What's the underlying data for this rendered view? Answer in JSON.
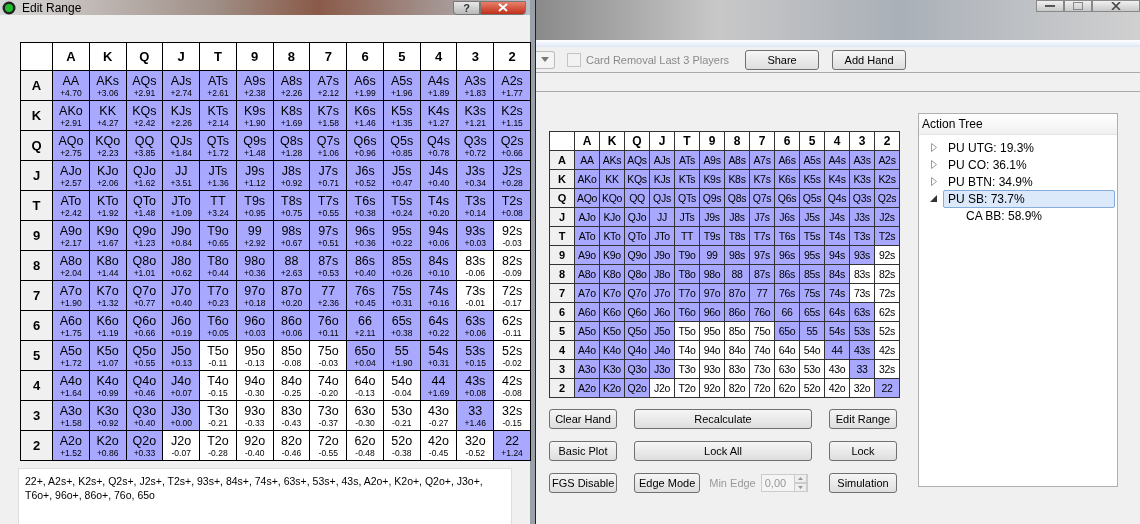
{
  "dialog": {
    "title": "Edit Range",
    "help_button": "?",
    "columns": [
      "A",
      "K",
      "Q",
      "J",
      "T",
      "9",
      "8",
      "7",
      "6",
      "5",
      "4",
      "3",
      "2"
    ],
    "rows": [
      {
        "rank": "A",
        "cells": [
          {
            "hand": "AA",
            "ev": "+4.70",
            "selected": true
          },
          {
            "hand": "AKs",
            "ev": "+3.06",
            "selected": true
          },
          {
            "hand": "AQs",
            "ev": "+2.91",
            "selected": true
          },
          {
            "hand": "AJs",
            "ev": "+2.74",
            "selected": true
          },
          {
            "hand": "ATs",
            "ev": "+2.61",
            "selected": true
          },
          {
            "hand": "A9s",
            "ev": "+2.38",
            "selected": true
          },
          {
            "hand": "A8s",
            "ev": "+2.26",
            "selected": true
          },
          {
            "hand": "A7s",
            "ev": "+2.12",
            "selected": true
          },
          {
            "hand": "A6s",
            "ev": "+1.99",
            "selected": true
          },
          {
            "hand": "A5s",
            "ev": "+1.96",
            "selected": true
          },
          {
            "hand": "A4s",
            "ev": "+1.89",
            "selected": true
          },
          {
            "hand": "A3s",
            "ev": "+1.83",
            "selected": true
          },
          {
            "hand": "A2s",
            "ev": "+1.77",
            "selected": true
          }
        ]
      },
      {
        "rank": "K",
        "cells": [
          {
            "hand": "AKo",
            "ev": "+2.91",
            "selected": true
          },
          {
            "hand": "KK",
            "ev": "+4.27",
            "selected": true
          },
          {
            "hand": "KQs",
            "ev": "+2.42",
            "selected": true
          },
          {
            "hand": "KJs",
            "ev": "+2.26",
            "selected": true
          },
          {
            "hand": "KTs",
            "ev": "+2.14",
            "selected": true
          },
          {
            "hand": "K9s",
            "ev": "+1.90",
            "selected": true
          },
          {
            "hand": "K8s",
            "ev": "+1.69",
            "selected": true
          },
          {
            "hand": "K7s",
            "ev": "+1.58",
            "selected": true
          },
          {
            "hand": "K6s",
            "ev": "+1.46",
            "selected": true
          },
          {
            "hand": "K5s",
            "ev": "+1.35",
            "selected": true
          },
          {
            "hand": "K4s",
            "ev": "+1.27",
            "selected": true
          },
          {
            "hand": "K3s",
            "ev": "+1.21",
            "selected": true
          },
          {
            "hand": "K2s",
            "ev": "+1.15",
            "selected": true
          }
        ]
      },
      {
        "rank": "Q",
        "cells": [
          {
            "hand": "AQo",
            "ev": "+2.75",
            "selected": true
          },
          {
            "hand": "KQo",
            "ev": "+2.23",
            "selected": true
          },
          {
            "hand": "QQ",
            "ev": "+3.85",
            "selected": true
          },
          {
            "hand": "QJs",
            "ev": "+1.84",
            "selected": true
          },
          {
            "hand": "QTs",
            "ev": "+1.72",
            "selected": true
          },
          {
            "hand": "Q9s",
            "ev": "+1.48",
            "selected": true
          },
          {
            "hand": "Q8s",
            "ev": "+1.28",
            "selected": true
          },
          {
            "hand": "Q7s",
            "ev": "+1.06",
            "selected": true
          },
          {
            "hand": "Q6s",
            "ev": "+0.96",
            "selected": true
          },
          {
            "hand": "Q5s",
            "ev": "+0.85",
            "selected": true
          },
          {
            "hand": "Q4s",
            "ev": "+0.78",
            "selected": true
          },
          {
            "hand": "Q3s",
            "ev": "+0.72",
            "selected": true
          },
          {
            "hand": "Q2s",
            "ev": "+0.66",
            "selected": true
          }
        ]
      },
      {
        "rank": "J",
        "cells": [
          {
            "hand": "AJo",
            "ev": "+2.57",
            "selected": true
          },
          {
            "hand": "KJo",
            "ev": "+2.06",
            "selected": true
          },
          {
            "hand": "QJo",
            "ev": "+1.62",
            "selected": true
          },
          {
            "hand": "JJ",
            "ev": "+3.51",
            "selected": true
          },
          {
            "hand": "JTs",
            "ev": "+1.36",
            "selected": true
          },
          {
            "hand": "J9s",
            "ev": "+1.12",
            "selected": true
          },
          {
            "hand": "J8s",
            "ev": "+0.92",
            "selected": true
          },
          {
            "hand": "J7s",
            "ev": "+0.71",
            "selected": true
          },
          {
            "hand": "J6s",
            "ev": "+0.52",
            "selected": true
          },
          {
            "hand": "J5s",
            "ev": "+0.47",
            "selected": true
          },
          {
            "hand": "J4s",
            "ev": "+0.40",
            "selected": true
          },
          {
            "hand": "J3s",
            "ev": "+0.34",
            "selected": true
          },
          {
            "hand": "J2s",
            "ev": "+0.28",
            "selected": true
          }
        ]
      },
      {
        "rank": "T",
        "cells": [
          {
            "hand": "ATo",
            "ev": "+2.42",
            "selected": true
          },
          {
            "hand": "KTo",
            "ev": "+1.92",
            "selected": true
          },
          {
            "hand": "QTo",
            "ev": "+1.48",
            "selected": true
          },
          {
            "hand": "JTo",
            "ev": "+1.09",
            "selected": true
          },
          {
            "hand": "TT",
            "ev": "+3.24",
            "selected": true
          },
          {
            "hand": "T9s",
            "ev": "+0.95",
            "selected": true
          },
          {
            "hand": "T8s",
            "ev": "+0.75",
            "selected": true
          },
          {
            "hand": "T7s",
            "ev": "+0.55",
            "selected": true
          },
          {
            "hand": "T6s",
            "ev": "+0.38",
            "selected": true
          },
          {
            "hand": "T5s",
            "ev": "+0.24",
            "selected": true
          },
          {
            "hand": "T4s",
            "ev": "+0.20",
            "selected": true
          },
          {
            "hand": "T3s",
            "ev": "+0.14",
            "selected": true
          },
          {
            "hand": "T2s",
            "ev": "+0.08",
            "selected": true
          }
        ]
      },
      {
        "rank": "9",
        "cells": [
          {
            "hand": "A9o",
            "ev": "+2.17",
            "selected": true
          },
          {
            "hand": "K9o",
            "ev": "+1.67",
            "selected": true
          },
          {
            "hand": "Q9o",
            "ev": "+1.23",
            "selected": true
          },
          {
            "hand": "J9o",
            "ev": "+0.84",
            "selected": true
          },
          {
            "hand": "T9o",
            "ev": "+0.65",
            "selected": true
          },
          {
            "hand": "99",
            "ev": "+2.92",
            "selected": true
          },
          {
            "hand": "98s",
            "ev": "+0.67",
            "selected": true
          },
          {
            "hand": "97s",
            "ev": "+0.51",
            "selected": true
          },
          {
            "hand": "96s",
            "ev": "+0.36",
            "selected": true
          },
          {
            "hand": "95s",
            "ev": "+0.22",
            "selected": true
          },
          {
            "hand": "94s",
            "ev": "+0.06",
            "selected": true
          },
          {
            "hand": "93s",
            "ev": "+0.03",
            "selected": true
          },
          {
            "hand": "92s",
            "ev": "-0.03",
            "selected": false
          }
        ]
      },
      {
        "rank": "8",
        "cells": [
          {
            "hand": "A8o",
            "ev": "+2.04",
            "selected": true
          },
          {
            "hand": "K8o",
            "ev": "+1.44",
            "selected": true
          },
          {
            "hand": "Q8o",
            "ev": "+1.01",
            "selected": true
          },
          {
            "hand": "J8o",
            "ev": "+0.62",
            "selected": true
          },
          {
            "hand": "T8o",
            "ev": "+0.44",
            "selected": true
          },
          {
            "hand": "98o",
            "ev": "+0.36",
            "selected": true
          },
          {
            "hand": "88",
            "ev": "+2.63",
            "selected": true
          },
          {
            "hand": "87s",
            "ev": "+0.53",
            "selected": true
          },
          {
            "hand": "86s",
            "ev": "+0.40",
            "selected": true
          },
          {
            "hand": "85s",
            "ev": "+0.26",
            "selected": true
          },
          {
            "hand": "84s",
            "ev": "+0.10",
            "selected": true
          },
          {
            "hand": "83s",
            "ev": "-0.06",
            "selected": false
          },
          {
            "hand": "82s",
            "ev": "-0.09",
            "selected": false
          }
        ]
      },
      {
        "rank": "7",
        "cells": [
          {
            "hand": "A7o",
            "ev": "+1.90",
            "selected": true
          },
          {
            "hand": "K7o",
            "ev": "+1.32",
            "selected": true
          },
          {
            "hand": "Q7o",
            "ev": "+0.77",
            "selected": true
          },
          {
            "hand": "J7o",
            "ev": "+0.40",
            "selected": true
          },
          {
            "hand": "T7o",
            "ev": "+0.23",
            "selected": true
          },
          {
            "hand": "97o",
            "ev": "+0.18",
            "selected": true
          },
          {
            "hand": "87o",
            "ev": "+0.20",
            "selected": true
          },
          {
            "hand": "77",
            "ev": "+2.36",
            "selected": true
          },
          {
            "hand": "76s",
            "ev": "+0.45",
            "selected": true
          },
          {
            "hand": "75s",
            "ev": "+0.31",
            "selected": true
          },
          {
            "hand": "74s",
            "ev": "+0.16",
            "selected": true
          },
          {
            "hand": "73s",
            "ev": "-0.01",
            "selected": false
          },
          {
            "hand": "72s",
            "ev": "-0.17",
            "selected": false
          }
        ]
      },
      {
        "rank": "6",
        "cells": [
          {
            "hand": "A6o",
            "ev": "+1.75",
            "selected": true
          },
          {
            "hand": "K6o",
            "ev": "+1.19",
            "selected": true
          },
          {
            "hand": "Q6o",
            "ev": "+0.66",
            "selected": true
          },
          {
            "hand": "J6o",
            "ev": "+0.19",
            "selected": true
          },
          {
            "hand": "T6o",
            "ev": "+0.05",
            "selected": true
          },
          {
            "hand": "96o",
            "ev": "+0.03",
            "selected": true
          },
          {
            "hand": "86o",
            "ev": "+0.06",
            "selected": true
          },
          {
            "hand": "76o",
            "ev": "+0.11",
            "selected": true
          },
          {
            "hand": "66",
            "ev": "+2.11",
            "selected": true
          },
          {
            "hand": "65s",
            "ev": "+0.38",
            "selected": true
          },
          {
            "hand": "64s",
            "ev": "+0.22",
            "selected": true
          },
          {
            "hand": "63s",
            "ev": "+0.06",
            "selected": true
          },
          {
            "hand": "62s",
            "ev": "-0.11",
            "selected": false
          }
        ]
      },
      {
        "rank": "5",
        "cells": [
          {
            "hand": "A5o",
            "ev": "+1.72",
            "selected": true
          },
          {
            "hand": "K5o",
            "ev": "+1.07",
            "selected": true
          },
          {
            "hand": "Q5o",
            "ev": "+0.55",
            "selected": true
          },
          {
            "hand": "J5o",
            "ev": "+0.13",
            "selected": true
          },
          {
            "hand": "T5o",
            "ev": "-0.11",
            "selected": false
          },
          {
            "hand": "95o",
            "ev": "-0.13",
            "selected": false
          },
          {
            "hand": "85o",
            "ev": "-0.08",
            "selected": false
          },
          {
            "hand": "75o",
            "ev": "-0.03",
            "selected": false
          },
          {
            "hand": "65o",
            "ev": "+0.04",
            "selected": true
          },
          {
            "hand": "55",
            "ev": "+1.90",
            "selected": true
          },
          {
            "hand": "54s",
            "ev": "+0.31",
            "selected": true
          },
          {
            "hand": "53s",
            "ev": "+0.15",
            "selected": true
          },
          {
            "hand": "52s",
            "ev": "-0.02",
            "selected": false
          }
        ]
      },
      {
        "rank": "4",
        "cells": [
          {
            "hand": "A4o",
            "ev": "+1.64",
            "selected": true
          },
          {
            "hand": "K4o",
            "ev": "+0.99",
            "selected": true
          },
          {
            "hand": "Q4o",
            "ev": "+0.46",
            "selected": true
          },
          {
            "hand": "J4o",
            "ev": "+0.07",
            "selected": true
          },
          {
            "hand": "T4o",
            "ev": "-0.15",
            "selected": false
          },
          {
            "hand": "94o",
            "ev": "-0.30",
            "selected": false
          },
          {
            "hand": "84o",
            "ev": "-0.25",
            "selected": false
          },
          {
            "hand": "74o",
            "ev": "-0.20",
            "selected": false
          },
          {
            "hand": "64o",
            "ev": "-0.13",
            "selected": false
          },
          {
            "hand": "54o",
            "ev": "-0.04",
            "selected": false
          },
          {
            "hand": "44",
            "ev": "+1.69",
            "selected": true
          },
          {
            "hand": "43s",
            "ev": "+0.08",
            "selected": true
          },
          {
            "hand": "42s",
            "ev": "-0.08",
            "selected": false
          }
        ]
      },
      {
        "rank": "3",
        "cells": [
          {
            "hand": "A3o",
            "ev": "+1.58",
            "selected": true
          },
          {
            "hand": "K3o",
            "ev": "+0.92",
            "selected": true
          },
          {
            "hand": "Q3o",
            "ev": "+0.40",
            "selected": true
          },
          {
            "hand": "J3o",
            "ev": "+0.00",
            "selected": true
          },
          {
            "hand": "T3o",
            "ev": "-0.21",
            "selected": false
          },
          {
            "hand": "93o",
            "ev": "-0.33",
            "selected": false
          },
          {
            "hand": "83o",
            "ev": "-0.43",
            "selected": false
          },
          {
            "hand": "73o",
            "ev": "-0.37",
            "selected": false
          },
          {
            "hand": "63o",
            "ev": "-0.30",
            "selected": false
          },
          {
            "hand": "53o",
            "ev": "-0.21",
            "selected": false
          },
          {
            "hand": "43o",
            "ev": "-0.27",
            "selected": false
          },
          {
            "hand": "33",
            "ev": "+1.46",
            "selected": true
          },
          {
            "hand": "32s",
            "ev": "-0.15",
            "selected": false
          }
        ]
      },
      {
        "rank": "2",
        "cells": [
          {
            "hand": "A2o",
            "ev": "+1.52",
            "selected": true
          },
          {
            "hand": "K2o",
            "ev": "+0.86",
            "selected": true
          },
          {
            "hand": "Q2o",
            "ev": "+0.33",
            "selected": true
          },
          {
            "hand": "J2o",
            "ev": "-0.07",
            "selected": false
          },
          {
            "hand": "T2o",
            "ev": "-0.28",
            "selected": false
          },
          {
            "hand": "92o",
            "ev": "-0.40",
            "selected": false
          },
          {
            "hand": "82o",
            "ev": "-0.46",
            "selected": false
          },
          {
            "hand": "72o",
            "ev": "-0.55",
            "selected": false
          },
          {
            "hand": "62o",
            "ev": "-0.48",
            "selected": false
          },
          {
            "hand": "52o",
            "ev": "-0.38",
            "selected": false
          },
          {
            "hand": "42o",
            "ev": "-0.45",
            "selected": false
          },
          {
            "hand": "32o",
            "ev": "-0.52",
            "selected": false
          },
          {
            "hand": "22",
            "ev": "+1.24",
            "selected": true
          }
        ]
      }
    ],
    "range_text": "22+, A2s+, K2s+, Q2s+, J2s+, T2s+, 93s+, 84s+, 74s+, 63s+, 53s+, 43s, A2o+, K2o+, Q2o+, J3o+, T6o+, 96o+, 86o+, 76o, 65o"
  },
  "main": {
    "toolbar": {
      "card_removal": {
        "label": "Card Removal Last 3 Players",
        "checked": false,
        "disabled": true
      },
      "buttons": [
        "Share",
        "Add Hand"
      ]
    },
    "grid": {
      "columns": [
        "A",
        "K",
        "Q",
        "J",
        "T",
        "9",
        "8",
        "7",
        "6",
        "5",
        "4",
        "3",
        "2"
      ],
      "rows": [
        {
          "rank": "A",
          "cells": [
            {
              "hand": "AA",
              "selected": true
            },
            {
              "hand": "AKs",
              "selected": true
            },
            {
              "hand": "AQs",
              "selected": true
            },
            {
              "hand": "AJs",
              "selected": true
            },
            {
              "hand": "ATs",
              "selected": true
            },
            {
              "hand": "A9s",
              "selected": true
            },
            {
              "hand": "A8s",
              "selected": true
            },
            {
              "hand": "A7s",
              "selected": true
            },
            {
              "hand": "A6s",
              "selected": true
            },
            {
              "hand": "A5s",
              "selected": true
            },
            {
              "hand": "A4s",
              "selected": true
            },
            {
              "hand": "A3s",
              "selected": true
            },
            {
              "hand": "A2s",
              "selected": true
            }
          ]
        },
        {
          "rank": "K",
          "cells": [
            {
              "hand": "AKo",
              "selected": true
            },
            {
              "hand": "KK",
              "selected": true
            },
            {
              "hand": "KQs",
              "selected": true
            },
            {
              "hand": "KJs",
              "selected": true
            },
            {
              "hand": "KTs",
              "selected": true
            },
            {
              "hand": "K9s",
              "selected": true
            },
            {
              "hand": "K8s",
              "selected": true
            },
            {
              "hand": "K7s",
              "selected": true
            },
            {
              "hand": "K6s",
              "selected": true
            },
            {
              "hand": "K5s",
              "selected": true
            },
            {
              "hand": "K4s",
              "selected": true
            },
            {
              "hand": "K3s",
              "selected": true
            },
            {
              "hand": "K2s",
              "selected": true
            }
          ]
        },
        {
          "rank": "Q",
          "cells": [
            {
              "hand": "AQo",
              "selected": true
            },
            {
              "hand": "KQo",
              "selected": true
            },
            {
              "hand": "QQ",
              "selected": true
            },
            {
              "hand": "QJs",
              "selected": true
            },
            {
              "hand": "QTs",
              "selected": true
            },
            {
              "hand": "Q9s",
              "selected": true
            },
            {
              "hand": "Q8s",
              "selected": true
            },
            {
              "hand": "Q7s",
              "selected": true
            },
            {
              "hand": "Q6s",
              "selected": true
            },
            {
              "hand": "Q5s",
              "selected": true
            },
            {
              "hand": "Q4s",
              "selected": true
            },
            {
              "hand": "Q3s",
              "selected": true
            },
            {
              "hand": "Q2s",
              "selected": true
            }
          ]
        },
        {
          "rank": "J",
          "cells": [
            {
              "hand": "AJo",
              "selected": true
            },
            {
              "hand": "KJo",
              "selected": true
            },
            {
              "hand": "QJo",
              "selected": true
            },
            {
              "hand": "JJ",
              "selected": true
            },
            {
              "hand": "JTs",
              "selected": true
            },
            {
              "hand": "J9s",
              "selected": true
            },
            {
              "hand": "J8s",
              "selected": true
            },
            {
              "hand": "J7s",
              "selected": true
            },
            {
              "hand": "J6s",
              "selected": true
            },
            {
              "hand": "J5s",
              "selected": true
            },
            {
              "hand": "J4s",
              "selected": true
            },
            {
              "hand": "J3s",
              "selected": true
            },
            {
              "hand": "J2s",
              "selected": true
            }
          ]
        },
        {
          "rank": "T",
          "cells": [
            {
              "hand": "ATo",
              "selected": true
            },
            {
              "hand": "KTo",
              "selected": true
            },
            {
              "hand": "QTo",
              "selected": true
            },
            {
              "hand": "JTo",
              "selected": true
            },
            {
              "hand": "TT",
              "selected": true
            },
            {
              "hand": "T9s",
              "selected": true
            },
            {
              "hand": "T8s",
              "selected": true
            },
            {
              "hand": "T7s",
              "selected": true
            },
            {
              "hand": "T6s",
              "selected": true
            },
            {
              "hand": "T5s",
              "selected": true
            },
            {
              "hand": "T4s",
              "selected": true
            },
            {
              "hand": "T3s",
              "selected": true
            },
            {
              "hand": "T2s",
              "selected": true
            }
          ]
        },
        {
          "rank": "9",
          "cells": [
            {
              "hand": "A9o",
              "selected": true
            },
            {
              "hand": "K9o",
              "selected": true
            },
            {
              "hand": "Q9o",
              "selected": true
            },
            {
              "hand": "J9o",
              "selected": true
            },
            {
              "hand": "T9o",
              "selected": true
            },
            {
              "hand": "99",
              "selected": true
            },
            {
              "hand": "98s",
              "selected": true
            },
            {
              "hand": "97s",
              "selected": true
            },
            {
              "hand": "96s",
              "selected": true
            },
            {
              "hand": "95s",
              "selected": true
            },
            {
              "hand": "94s",
              "selected": true
            },
            {
              "hand": "93s",
              "selected": true
            },
            {
              "hand": "92s",
              "selected": false
            }
          ]
        },
        {
          "rank": "8",
          "cells": [
            {
              "hand": "A8o",
              "selected": true
            },
            {
              "hand": "K8o",
              "selected": true
            },
            {
              "hand": "Q8o",
              "selected": true
            },
            {
              "hand": "J8o",
              "selected": true
            },
            {
              "hand": "T8o",
              "selected": true
            },
            {
              "hand": "98o",
              "selected": true
            },
            {
              "hand": "88",
              "selected": true
            },
            {
              "hand": "87s",
              "selected": true
            },
            {
              "hand": "86s",
              "selected": true
            },
            {
              "hand": "85s",
              "selected": true
            },
            {
              "hand": "84s",
              "selected": true
            },
            {
              "hand": "83s",
              "selected": false
            },
            {
              "hand": "82s",
              "selected": false
            }
          ]
        },
        {
          "rank": "7",
          "cells": [
            {
              "hand": "A7o",
              "selected": true
            },
            {
              "hand": "K7o",
              "selected": true
            },
            {
              "hand": "Q7o",
              "selected": true
            },
            {
              "hand": "J7o",
              "selected": true
            },
            {
              "hand": "T7o",
              "selected": true
            },
            {
              "hand": "97o",
              "selected": true
            },
            {
              "hand": "87o",
              "selected": true
            },
            {
              "hand": "77",
              "selected": true
            },
            {
              "hand": "76s",
              "selected": true
            },
            {
              "hand": "75s",
              "selected": true
            },
            {
              "hand": "74s",
              "selected": true
            },
            {
              "hand": "73s",
              "selected": false
            },
            {
              "hand": "72s",
              "selected": false
            }
          ]
        },
        {
          "rank": "6",
          "cells": [
            {
              "hand": "A6o",
              "selected": true
            },
            {
              "hand": "K6o",
              "selected": true
            },
            {
              "hand": "Q6o",
              "selected": true
            },
            {
              "hand": "J6o",
              "selected": true
            },
            {
              "hand": "T6o",
              "selected": true
            },
            {
              "hand": "96o",
              "selected": true
            },
            {
              "hand": "86o",
              "selected": true
            },
            {
              "hand": "76o",
              "selected": true
            },
            {
              "hand": "66",
              "selected": true
            },
            {
              "hand": "65s",
              "selected": true
            },
            {
              "hand": "64s",
              "selected": true
            },
            {
              "hand": "63s",
              "selected": true
            },
            {
              "hand": "62s",
              "selected": false
            }
          ]
        },
        {
          "rank": "5",
          "cells": [
            {
              "hand": "A5o",
              "selected": true
            },
            {
              "hand": "K5o",
              "selected": true
            },
            {
              "hand": "Q5o",
              "selected": true
            },
            {
              "hand": "J5o",
              "selected": true
            },
            {
              "hand": "T5o",
              "selected": false
            },
            {
              "hand": "95o",
              "selected": false
            },
            {
              "hand": "85o",
              "selected": false
            },
            {
              "hand": "75o",
              "selected": false
            },
            {
              "hand": "65o",
              "selected": true
            },
            {
              "hand": "55",
              "selected": true
            },
            {
              "hand": "54s",
              "selected": true
            },
            {
              "hand": "53s",
              "selected": true
            },
            {
              "hand": "52s",
              "selected": false
            }
          ]
        },
        {
          "rank": "4",
          "cells": [
            {
              "hand": "A4o",
              "selected": true
            },
            {
              "hand": "K4o",
              "selected": true
            },
            {
              "hand": "Q4o",
              "selected": true
            },
            {
              "hand": "J4o",
              "selected": true
            },
            {
              "hand": "T4o",
              "selected": false
            },
            {
              "hand": "94o",
              "selected": false
            },
            {
              "hand": "84o",
              "selected": false
            },
            {
              "hand": "74o",
              "selected": false
            },
            {
              "hand": "64o",
              "selected": false
            },
            {
              "hand": "54o",
              "selected": false
            },
            {
              "hand": "44",
              "selected": true
            },
            {
              "hand": "43s",
              "selected": true
            },
            {
              "hand": "42s",
              "selected": false
            }
          ]
        },
        {
          "rank": "3",
          "cells": [
            {
              "hand": "A3o",
              "selected": true
            },
            {
              "hand": "K3o",
              "selected": true
            },
            {
              "hand": "Q3o",
              "selected": true
            },
            {
              "hand": "J3o",
              "selected": true
            },
            {
              "hand": "T3o",
              "selected": false
            },
            {
              "hand": "93o",
              "selected": false
            },
            {
              "hand": "83o",
              "selected": false
            },
            {
              "hand": "73o",
              "selected": false
            },
            {
              "hand": "63o",
              "selected": false
            },
            {
              "hand": "53o",
              "selected": false
            },
            {
              "hand": "43o",
              "selected": false
            },
            {
              "hand": "33",
              "selected": true
            },
            {
              "hand": "32s",
              "selected": false
            }
          ]
        },
        {
          "rank": "2",
          "cells": [
            {
              "hand": "A2o",
              "selected": true
            },
            {
              "hand": "K2o",
              "selected": true
            },
            {
              "hand": "Q2o",
              "selected": true
            },
            {
              "hand": "J2o",
              "selected": false
            },
            {
              "hand": "T2o",
              "selected": false
            },
            {
              "hand": "92o",
              "selected": false
            },
            {
              "hand": "82o",
              "selected": false
            },
            {
              "hand": "72o",
              "selected": false
            },
            {
              "hand": "62o",
              "selected": false
            },
            {
              "hand": "52o",
              "selected": false
            },
            {
              "hand": "42o",
              "selected": false
            },
            {
              "hand": "32o",
              "selected": false
            },
            {
              "hand": "22",
              "selected": true
            }
          ]
        }
      ]
    },
    "action_tree": {
      "title": "Action Tree",
      "items": [
        {
          "label": "PU UTG: 19.3%",
          "expanded": false,
          "selected": false
        },
        {
          "label": "PU CO: 36.1%",
          "expanded": false,
          "selected": false
        },
        {
          "label": "PU BTN: 34.9%",
          "expanded": false,
          "selected": false
        },
        {
          "label": "PU SB: 73.7%",
          "expanded": true,
          "selected": true,
          "children": [
            {
              "label": "CA BB: 58.9%",
              "selected": false
            }
          ]
        }
      ]
    },
    "button_rows": [
      {
        "left": "Clear Hand",
        "middle": [
          {
            "kind": "button",
            "label": "Recalculate"
          }
        ],
        "right": "Edit Range"
      },
      {
        "left": "Basic Plot",
        "middle": [
          {
            "kind": "button",
            "label": "Lock All"
          }
        ],
        "right": "Lock"
      },
      {
        "left": "FGS Disable",
        "middle": [
          {
            "kind": "button",
            "label": "Edge Mode"
          },
          {
            "kind": "spinner",
            "label": "Min Edge",
            "value": "0,00",
            "disabled": true
          }
        ],
        "right": "Simulation"
      }
    ]
  }
}
